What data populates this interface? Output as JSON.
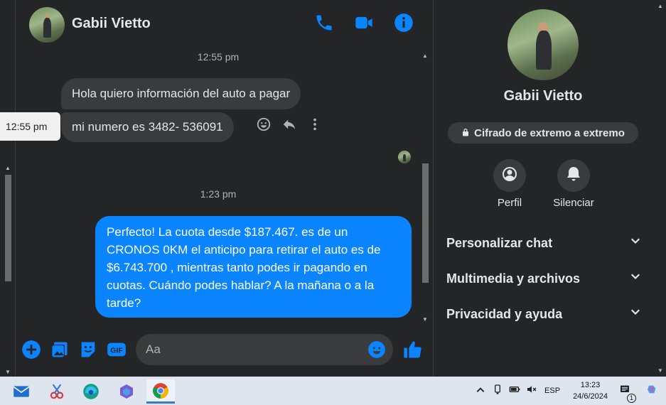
{
  "tooltip": {
    "time": "12:55 pm"
  },
  "header": {
    "name": "Gabii Vietto"
  },
  "messages": {
    "ts1": "12:55 pm",
    "msg1": "Hola quiero información del auto a pagar",
    "msg2": "mi numero es 3482- 536091",
    "ts2": "1:23 pm",
    "out1": "Perfecto! La cuota desde $187.467. es de un CRONOS 0KM el anticipo para retirar el auto es de $6.743.700 , mientras tanto podes ir pagando en cuotas. Cuándo podes hablar? A la mañana o a la tarde?"
  },
  "composer": {
    "placeholder": "Aa"
  },
  "info": {
    "name": "Gabii Vietto",
    "encryption": "Cifrado de extremo a extremo",
    "profile_label": "Perfil",
    "mute_label": "Silenciar",
    "sections": [
      "Personalizar chat",
      "Multimedia y archivos",
      "Privacidad y ayuda"
    ]
  },
  "taskbar": {
    "language": "ESP",
    "time": "13:23",
    "date": "24/6/2024",
    "notification_count": "1"
  },
  "colors": {
    "accent": "#0a84ff",
    "bg": "#242526",
    "bubble_in": "#3a3b3c"
  }
}
